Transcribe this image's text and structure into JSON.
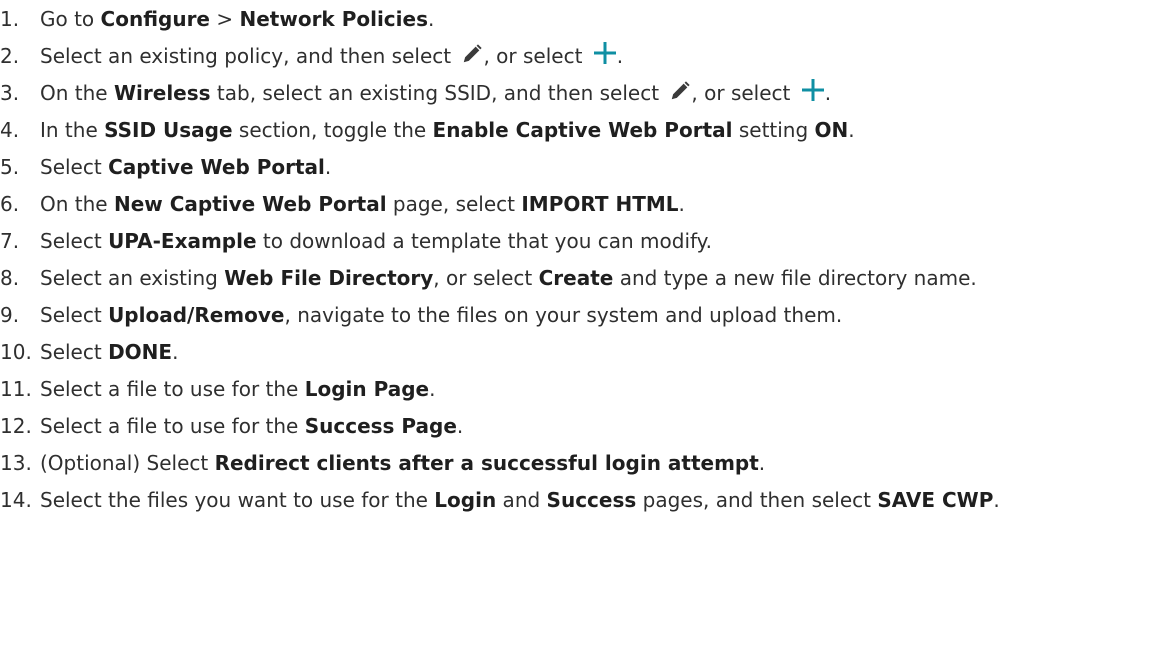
{
  "steps": [
    {
      "num": "1.",
      "parts": [
        "Go to ",
        "Configure",
        " > ",
        "Network Policies",
        "."
      ]
    },
    {
      "num": "2.",
      "parts": [
        "Select an existing policy, and then select ",
        ", or select ",
        "."
      ]
    },
    {
      "num": "3.",
      "parts": [
        "On the ",
        "Wireless",
        " tab, select an existing SSID, and then select ",
        ", or select ",
        "."
      ]
    },
    {
      "num": "4.",
      "parts": [
        "In the ",
        "SSID Usage",
        " section, toggle the ",
        "Enable Captive Web Portal",
        " setting ",
        "ON",
        "."
      ]
    },
    {
      "num": "5.",
      "parts": [
        "Select ",
        "Captive Web Portal",
        "."
      ]
    },
    {
      "num": "6.",
      "parts": [
        "On the ",
        "New Captive Web Portal",
        " page, select ",
        "IMPORT HTML",
        "."
      ]
    },
    {
      "num": "7.",
      "parts": [
        "Select ",
        "UPA-Example",
        " to download a template that you can modify."
      ]
    },
    {
      "num": "8.",
      "parts": [
        "Select an existing ",
        "Web File Directory",
        ", or select ",
        "Create",
        " and type a new file directory name."
      ]
    },
    {
      "num": "9.",
      "parts": [
        "Select ",
        "Upload/Remove",
        ", navigate to the files on your system and upload them."
      ]
    },
    {
      "num": "10.",
      "parts": [
        "Select ",
        "DONE",
        "."
      ]
    },
    {
      "num": "11.",
      "parts": [
        "Select a file to use for the ",
        "Login Page",
        "."
      ]
    },
    {
      "num": "12.",
      "parts": [
        "Select a file to use for the ",
        "Success Page",
        "."
      ]
    },
    {
      "num": "13.",
      "parts": [
        "(Optional) Select ",
        "Redirect clients after a successful login attempt",
        "."
      ]
    },
    {
      "num": "14.",
      "parts": [
        "Select the files you want to use for the ",
        "Login",
        " and ",
        "Success",
        " pages, and then select ",
        "SAVE CWP",
        "."
      ]
    }
  ],
  "icons": {
    "edit": "pencil-icon",
    "add": "plus-icon",
    "add_color": "#0f8fa3",
    "edit_color": "#3a3a3a"
  }
}
